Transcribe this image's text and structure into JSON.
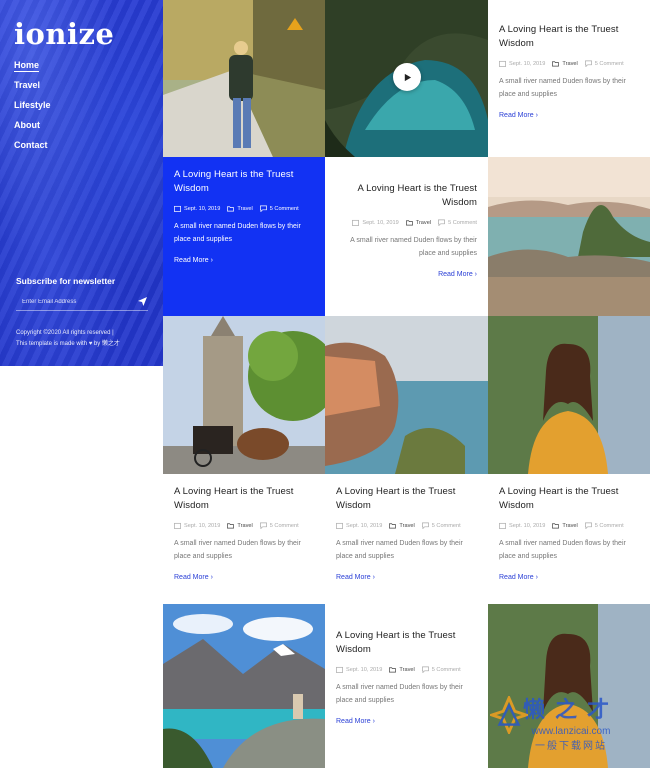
{
  "site": {
    "logo": "ionize",
    "nav": [
      "Home",
      "Travel",
      "Lifestyle",
      "About",
      "Contact"
    ],
    "newsletter_title": "Subscribe for newsletter",
    "newsletter_placeholder": "Enter Email Address",
    "copyright_line1": "Copyright ©2020 All rights reserved |",
    "copyright_line2": "This template is made with ♥ by 懒之才"
  },
  "post": {
    "title": "A Loving Heart is the Truest Wisdom",
    "date": "Sept. 10, 2019",
    "category": "Travel",
    "comments": "5 Comment",
    "excerpt": "A small river named Duden flows by their place and supplies",
    "read_more": "Read More ›"
  },
  "watermark": {
    "line1": "懒之才",
    "line2": "www.lanzicai.com",
    "line3": "一般下载网站"
  },
  "colors": {
    "accent": "#1232f3",
    "sidebar": "#2437cc",
    "link": "#2a3fd6"
  }
}
